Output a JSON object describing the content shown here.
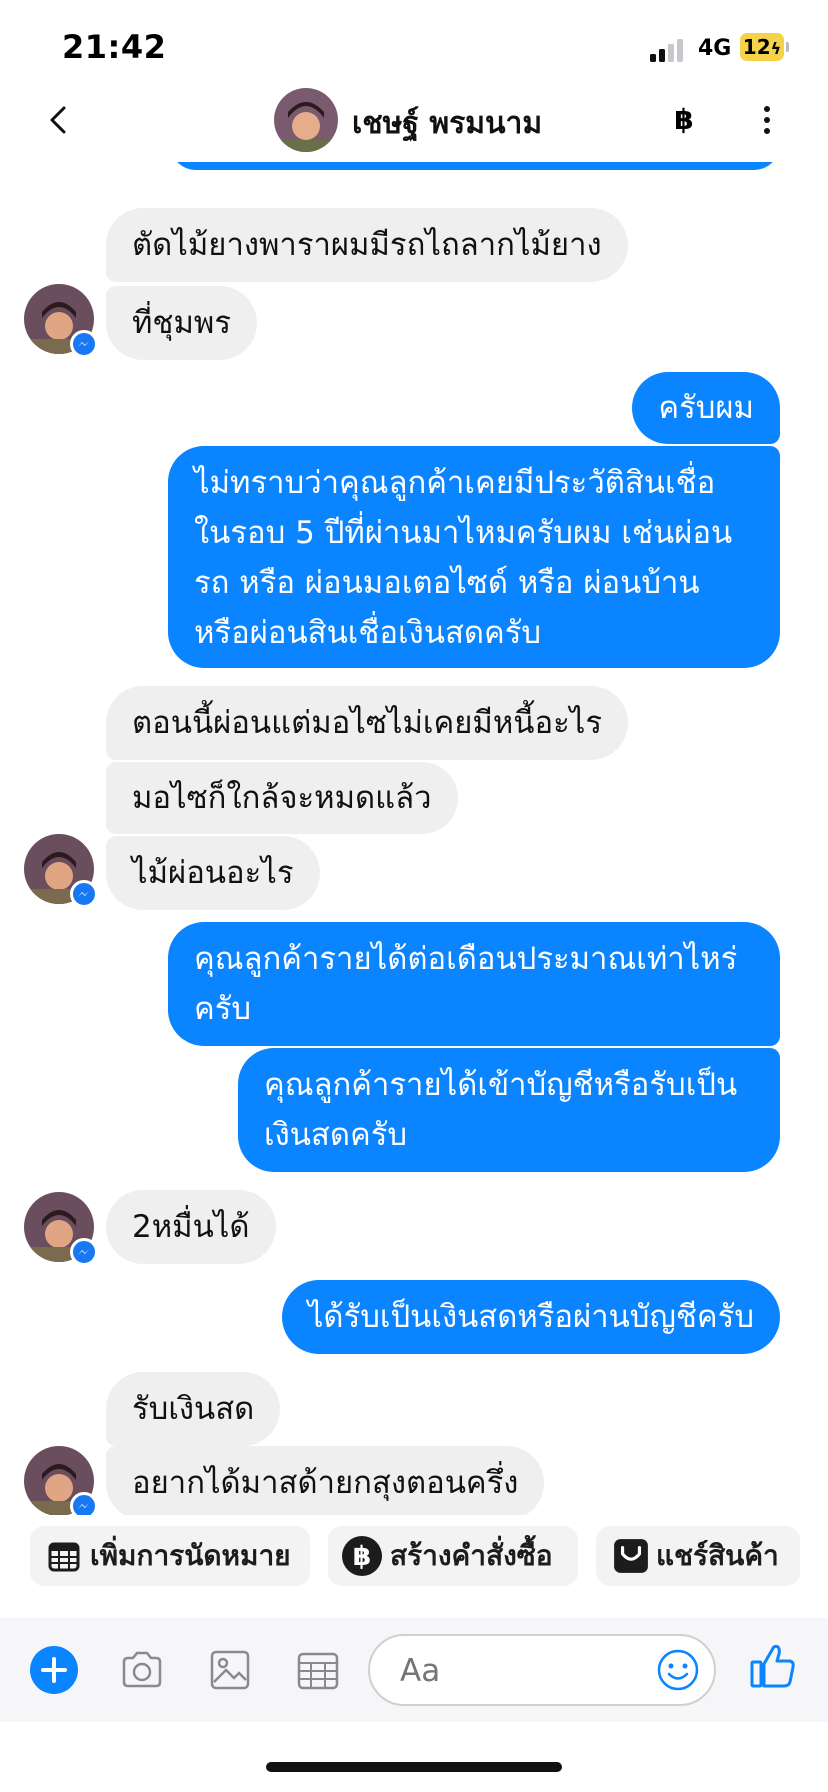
{
  "status_bar": {
    "time": "21:42",
    "network": "4G",
    "battery": "12"
  },
  "header": {
    "contact_name": "เชษฐ์ พรมนาม",
    "currency_symbol": "฿"
  },
  "colors": {
    "accent": "#0a84ff",
    "incoming_bubble": "#efefef",
    "messenger_blue": "#1877f2"
  },
  "messages": [
    {
      "side": "out",
      "text": ""
    },
    {
      "side": "in",
      "text": "ตัดไม้ยางพาราผมมีรถไถลากไม้ยาง"
    },
    {
      "side": "in",
      "text": "ที่ชุมพร"
    },
    {
      "side": "out",
      "text": "ครับผม"
    },
    {
      "side": "out",
      "lines": [
        "ไม่ทราบว่าคุณลูกค้าเคยมีประวัติสินเชื่อ",
        "ในรอบ 5 ปีที่ผ่านมาไหมครับผม เช่นผ่อน",
        "รถ หรือ ผ่อนมอเตอไซด์ หรือ ผ่อนบ้าน",
        "หรือผ่อนสินเชื่อเงินสดครับ"
      ]
    },
    {
      "side": "in",
      "text": "ตอนนี้ผ่อนแต่มอไซไม่เคยมีหนี้อะไร"
    },
    {
      "side": "in",
      "text": "มอไซก็ใกล้จะหมดแล้ว"
    },
    {
      "side": "in",
      "text": "ไม้ผ่อนอะไร"
    },
    {
      "side": "out",
      "lines": [
        "คุณลูกค้ารายได้ต่อเดือนประมาณเท่าไหร่",
        "ครับ"
      ]
    },
    {
      "side": "out",
      "lines": [
        "คุณลูกค้ารายได้เข้าบัญชีหรือรับเป็น",
        "เงินสดครับ"
      ]
    },
    {
      "side": "in",
      "text": "2หมื่นได้"
    },
    {
      "side": "out",
      "text": "ได้รับเป็นเงินสดหรือผ่านบัญชีครับ"
    },
    {
      "side": "in",
      "text": "รับเงินสด"
    },
    {
      "side": "in",
      "text": "อยากได้มาสด้ายกสุงตอนครึ่ง"
    }
  ],
  "quick_actions": [
    {
      "label": "เพิ่มการนัดหมาย",
      "icon": "calendar-icon"
    },
    {
      "label": "สร้างคำสั่งซื้อ",
      "icon": "baht-icon"
    },
    {
      "label": "แชร์สินค้า",
      "icon": "shopping-bag-icon"
    }
  ],
  "composer": {
    "placeholder": "Aa"
  }
}
